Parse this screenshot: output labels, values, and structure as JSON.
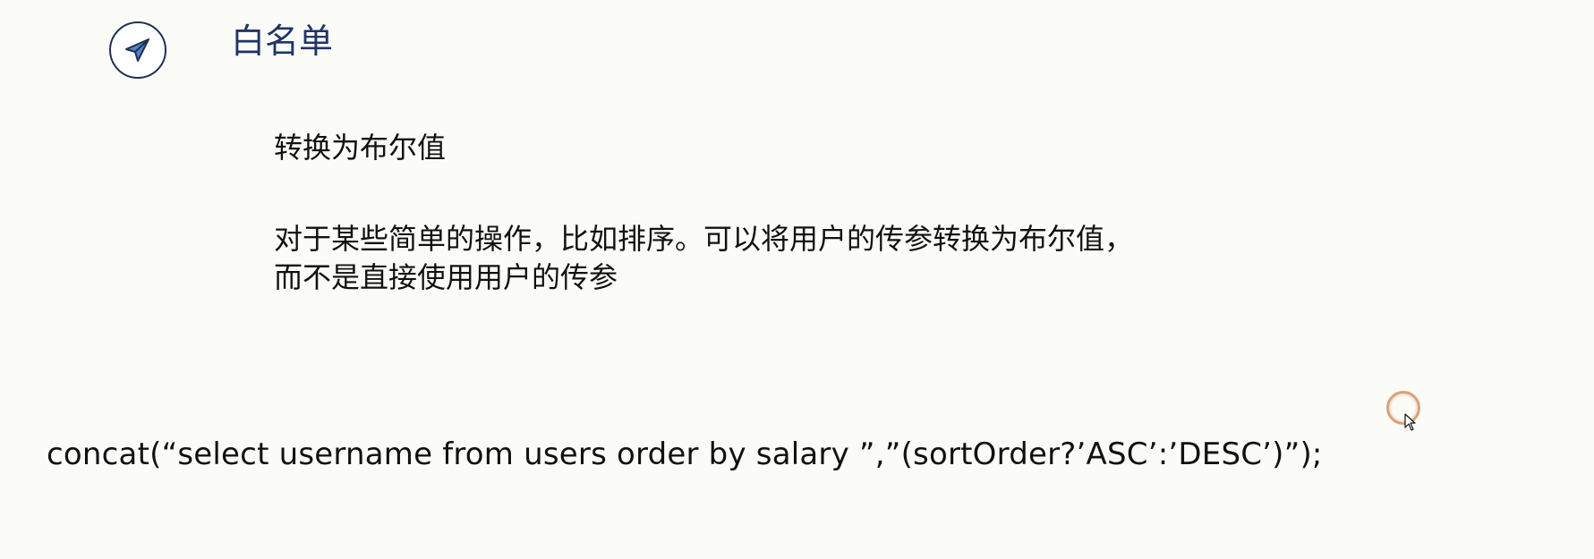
{
  "header": {
    "title": "白名单",
    "icon": "paper-plane-icon"
  },
  "content": {
    "subheading": "转换为布尔值",
    "description_lines": [
      "对于某些简单的操作，比如排序。可以将用户的传参转换为布尔值，",
      "而不是直接使用用户的传参"
    ],
    "code": "concat(“select username from users order by salary ”,”(sortOrder?’ASC’:’DESC’)”);"
  },
  "colors": {
    "title": "#1f3566",
    "icon_fill": "#4f86c6",
    "icon_border": "#1f2f4f",
    "cursor_ring": "#d9a27a"
  },
  "cursor": {
    "icon": "mouse-cursor-icon"
  }
}
